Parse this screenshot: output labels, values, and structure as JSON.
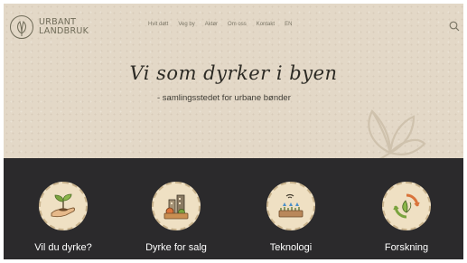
{
  "logo": {
    "line1": "URBANT",
    "line2": "LANDBRUK"
  },
  "nav": {
    "items": [
      "Hvit døtt",
      "Veg by",
      "Aktør",
      "Om oss",
      "Kontakt",
      "EN"
    ]
  },
  "hero": {
    "title": "Vi som dyrker i byen",
    "subtitle": "- samlingsstedet for urbane bønder"
  },
  "categories": [
    {
      "label": "Vil du dyrke?",
      "icon": "seedling-hand-icon"
    },
    {
      "label": "Dyrke for salg",
      "icon": "city-vegetables-icon"
    },
    {
      "label": "Teknologi",
      "icon": "technology-irrigation-icon"
    },
    {
      "label": "Forskning",
      "icon": "research-cycle-icon"
    }
  ],
  "colors": {
    "hero_bg": "#e3d8c7",
    "band_bg": "#2b2a2c",
    "icon_circle": "#efe0c3",
    "accent_green": "#6a9a3a"
  }
}
